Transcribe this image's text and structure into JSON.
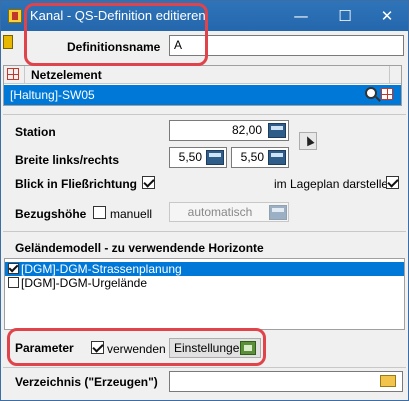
{
  "window": {
    "title": "Kanal - QS-Definition editieren",
    "min_icon": "minimize-icon",
    "max_icon": "maximize-icon",
    "close_icon": "close-icon"
  },
  "definition": {
    "label": "Definitionsname",
    "value": "A"
  },
  "netzelement": {
    "header": "Netzelement",
    "row_value": "[Haltung]-SW05"
  },
  "station": {
    "label": "Station",
    "value": "82,00"
  },
  "breite": {
    "label": "Breite links/rechts",
    "left_value": "5,50",
    "right_value": "5,50"
  },
  "blick": {
    "label": "Blick in Fließrichtung",
    "checked": true,
    "lageplan_label": "im Lageplan darstellen",
    "lageplan_checked": true
  },
  "bezug": {
    "label": "Bezugshöhe",
    "manuell_label": "manuell",
    "manuell_checked": false,
    "auto_value": "automatisch"
  },
  "gelaende": {
    "title": "Geländemodell - zu verwendende Horizonte",
    "items": [
      {
        "label": "[DGM]-DGM-Strassenplanung",
        "checked": true,
        "selected": true
      },
      {
        "label": "[DGM]-DGM-Urgelände",
        "checked": false,
        "selected": false
      }
    ]
  },
  "parameter": {
    "label": "Parameter",
    "verwenden_label": "verwenden",
    "verwenden_checked": true,
    "einstellungen_label": "Einstellungen"
  },
  "verzeichnis": {
    "label": "Verzeichnis (\"Erzeugen\")",
    "value": ""
  },
  "colors": {
    "titlebar": "#2b6cb0",
    "selection": "#0078d7",
    "highlight": "#e0444a"
  }
}
